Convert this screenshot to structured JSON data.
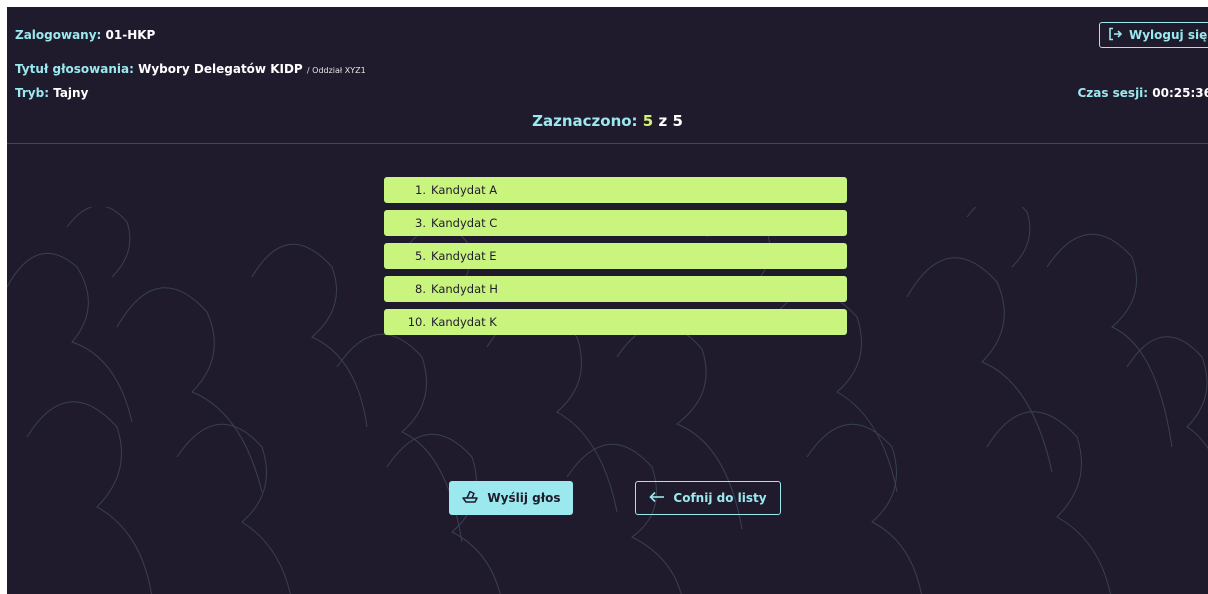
{
  "header": {
    "user_label": "Zalogowany:",
    "user_value": "01-HKP",
    "title_label": "Tytuł głosowania:",
    "title_value": "Wybory Delegatów KIDP",
    "title_sub": "/ Oddział XYZ1",
    "mode_label": "Tryb:",
    "mode_value": "Tajny",
    "timer_label": "Czas sesji:",
    "timer_value": "00:25:36",
    "logout_label": "Wyloguj się"
  },
  "counter": {
    "label": "Zaznaczono:",
    "selected": "5",
    "separator": "z",
    "total": "5"
  },
  "candidates": [
    {
      "num": "1.",
      "name": "Kandydat A"
    },
    {
      "num": "3.",
      "name": "Kandydat C"
    },
    {
      "num": "5.",
      "name": "Kandydat E"
    },
    {
      "num": "8.",
      "name": "Kandydat H"
    },
    {
      "num": "10.",
      "name": "Kandydat K"
    }
  ],
  "actions": {
    "send_label": "Wyślij głos",
    "back_label": "Cofnij do listy"
  },
  "icons": {
    "logout": "logout-icon",
    "send": "ballot-box-icon",
    "back": "arrow-left-icon"
  },
  "colors": {
    "background": "#1f1b2d",
    "accent": "#9be8ee",
    "selected": "#c9f57f",
    "highlight": "#d6f07a"
  }
}
